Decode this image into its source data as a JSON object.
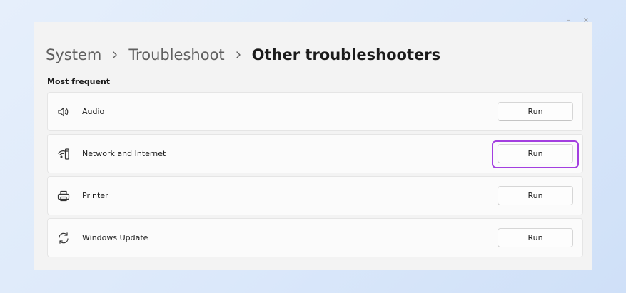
{
  "breadcrumb": {
    "items": [
      "System",
      "Troubleshoot"
    ],
    "current": "Other troubleshooters"
  },
  "section": {
    "title": "Most frequent"
  },
  "troubleshooters": [
    {
      "label": "Audio",
      "icon": "speaker-icon",
      "button": "Run"
    },
    {
      "label": "Network and Internet",
      "icon": "wifi-network-icon",
      "button": "Run",
      "highlighted": true,
      "highlight_color": "#a33fe0"
    },
    {
      "label": "Printer",
      "icon": "printer-icon",
      "button": "Run"
    },
    {
      "label": "Windows Update",
      "icon": "sync-icon",
      "button": "Run"
    }
  ],
  "colors": {
    "background": "#dbe8fa",
    "panel": "#f3f3f3",
    "card": "#fbfbfb",
    "highlight": "#a33fe0"
  }
}
